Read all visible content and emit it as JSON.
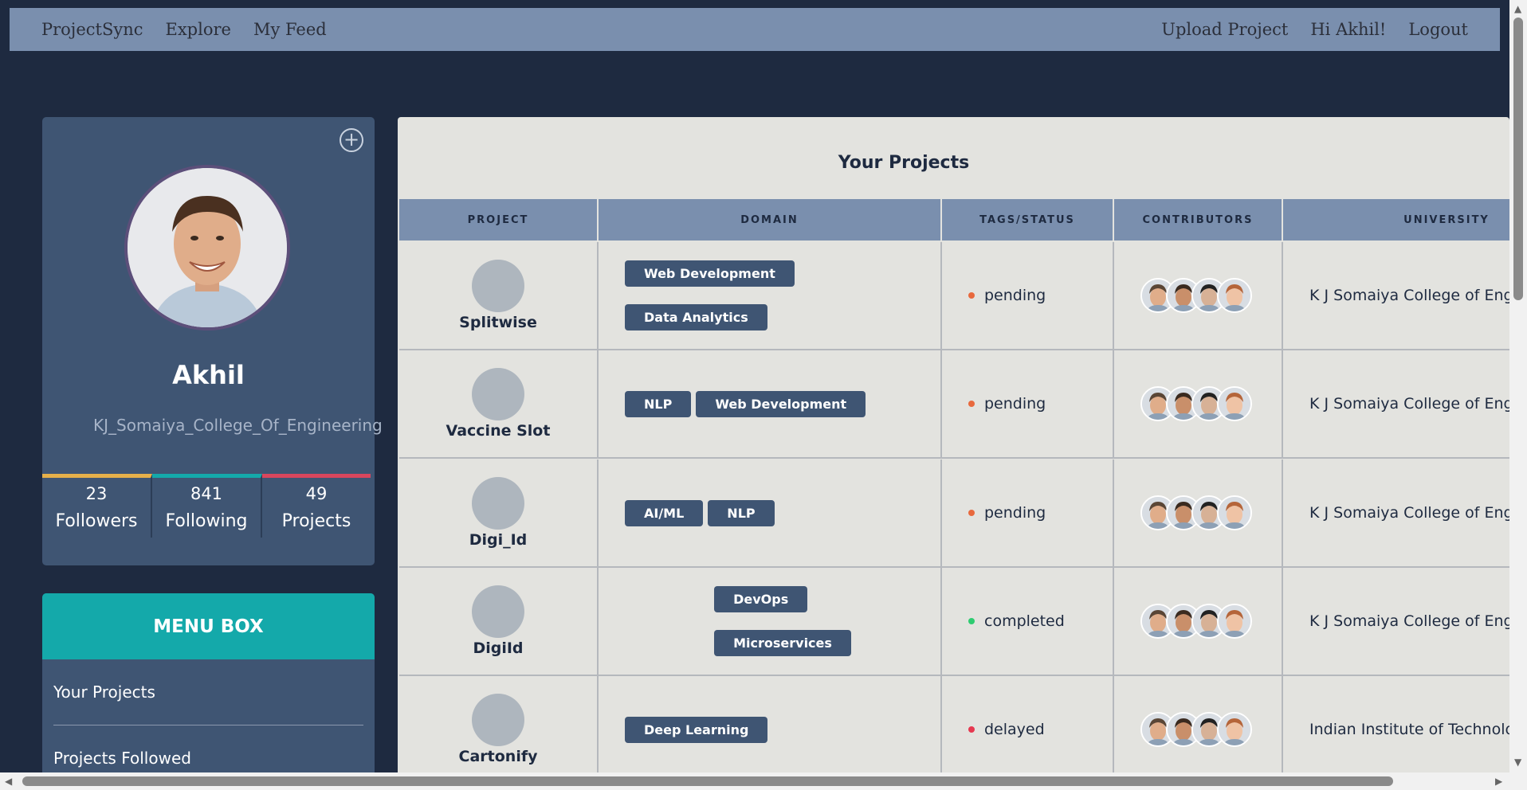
{
  "nav": {
    "brand": "ProjectSync",
    "explore": "Explore",
    "feed": "My Feed",
    "upload": "Upload Project",
    "greeting": "Hi Akhil!",
    "logout": "Logout"
  },
  "profile": {
    "name": "Akhil",
    "university": "KJ_Somaiya_College_Of_Engineering",
    "stats": [
      {
        "num": "23",
        "label": "Followers",
        "color": "#e6b04a"
      },
      {
        "num": "841",
        "label": "Following",
        "color": "#14a9aa"
      },
      {
        "num": "49",
        "label": "Projects",
        "color": "#d9465d"
      }
    ]
  },
  "menu": {
    "title": "MENU BOX",
    "items": [
      "Your Projects",
      "Projects Followed"
    ]
  },
  "projects": {
    "title": "Your Projects",
    "headers": [
      "PROJECT",
      "DOMAIN",
      "TAGS/STATUS",
      "CONTRIBUTORS",
      "UNIVERSITY"
    ],
    "rows": [
      {
        "name": "Splitwise",
        "domains": [
          "Web Development",
          "Data Analytics"
        ],
        "status": "pending",
        "status_color": "#e8693d",
        "university": "K J Somaiya College of Engir"
      },
      {
        "name": "Vaccine Slot",
        "domains": [
          "NLP",
          "Web Development"
        ],
        "status": "pending",
        "status_color": "#e8693d",
        "university": "K J Somaiya College of Engir"
      },
      {
        "name": "Digi_Id",
        "domains": [
          "AI/ML",
          "NLP"
        ],
        "status": "pending",
        "status_color": "#e8693d",
        "university": "K J Somaiya College of Engir"
      },
      {
        "name": "DigiId",
        "domains": [
          "DevOps",
          "Microservices"
        ],
        "status": "completed",
        "status_color": "#2ecc71",
        "university": "K J Somaiya College of Engir"
      },
      {
        "name": "Cartonify",
        "domains": [
          "Deep Learning"
        ],
        "status": "delayed",
        "status_color": "#e63950",
        "university": "Indian Institute of Technolog"
      }
    ]
  }
}
